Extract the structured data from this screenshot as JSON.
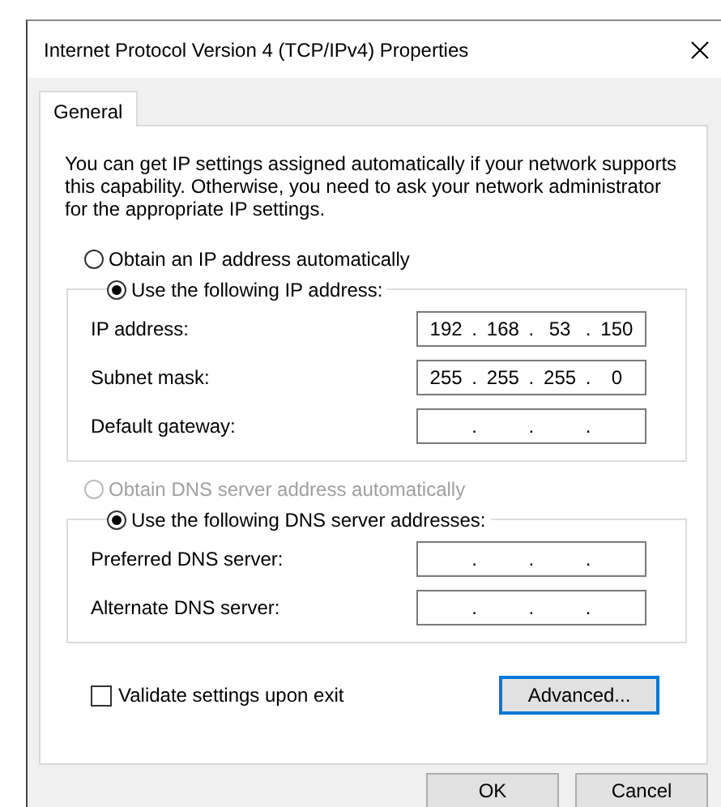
{
  "window": {
    "title": "Internet Protocol Version 4 (TCP/IPv4) Properties"
  },
  "tabs": [
    {
      "label": "General",
      "selected": true
    }
  ],
  "description": "You can get IP settings assigned automatically if your network supports this capability. Otherwise, you need to ask your network administrator for the appropriate IP settings.",
  "ip": {
    "auto_option": {
      "label": "Obtain an IP address automatically",
      "selected": false,
      "disabled": false
    },
    "manual_option": {
      "label": "Use the following IP address:",
      "selected": true,
      "disabled": false
    },
    "fields": [
      {
        "label": "IP address:",
        "octets": [
          "192",
          "168",
          "53",
          "150"
        ]
      },
      {
        "label": "Subnet mask:",
        "octets": [
          "255",
          "255",
          "255",
          "0"
        ]
      },
      {
        "label": "Default gateway:"
      }
    ]
  },
  "dns": {
    "auto_option": {
      "label": "Obtain DNS server address automatically",
      "selected": false,
      "disabled": true
    },
    "manual_option": {
      "label": "Use the following DNS server addresses:",
      "selected": true,
      "disabled": false
    },
    "fields": [
      {
        "label": "Preferred DNS server:"
      },
      {
        "label": "Alternate DNS server:"
      }
    ]
  },
  "separator": ".",
  "validate_checkbox": {
    "label": "Validate settings upon exit",
    "checked": false
  },
  "advanced_button": {
    "label": "Advanced...",
    "focused": true
  },
  "footer_buttons": [
    "OK",
    "Cancel"
  ]
}
